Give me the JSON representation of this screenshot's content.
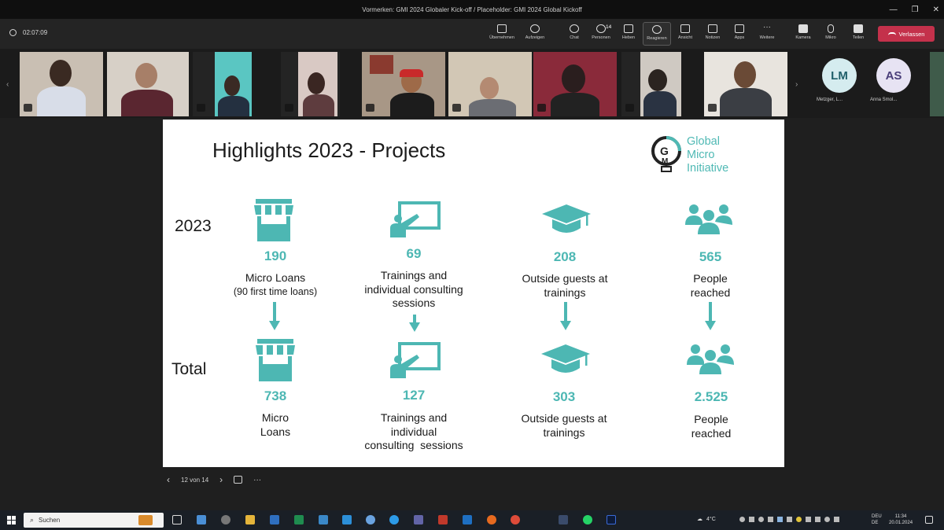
{
  "window": {
    "title": "Vormerken: GMI 2024 Globaler Kick-off / Placeholder: GMI 2024 Global Kickoff",
    "controls": [
      "minimize",
      "maximize",
      "close"
    ]
  },
  "meeting": {
    "timer": "02:07:09",
    "toolbar": [
      {
        "label": "Übernehmen",
        "icon": "share-icon"
      },
      {
        "label": "Aufzeigen",
        "icon": "raise-icon"
      },
      {
        "label": "Chat",
        "icon": "chat-icon"
      },
      {
        "label": "Personen",
        "icon": "people-icon",
        "badge": "14"
      },
      {
        "label": "Heben",
        "icon": "hand-icon"
      },
      {
        "label": "Reagieren",
        "icon": "react-icon"
      },
      {
        "label": "Ansicht",
        "icon": "grid-icon"
      },
      {
        "label": "Notizen",
        "icon": "notes-icon"
      },
      {
        "label": "Apps",
        "icon": "apps-icon"
      },
      {
        "label": "Weitere",
        "icon": "more-icon"
      },
      {
        "label": "Kamera",
        "icon": "camera-icon"
      },
      {
        "label": "Mikro",
        "icon": "mic-icon"
      },
      {
        "label": "Teilen",
        "icon": "share-screen-icon"
      }
    ],
    "leave_label": "Verlassen",
    "participants": [
      {
        "initials": "LM",
        "name": "Metzger, L..."
      },
      {
        "initials": "AS",
        "name": "Anna Smol..."
      }
    ],
    "badge_count": "14"
  },
  "slide": {
    "title": "Highlights 2023 - Projects",
    "logo_lines": [
      "Global",
      "Micro",
      "Initiative"
    ],
    "row_labels": [
      "2023",
      "Total"
    ],
    "columns": [
      {
        "icon": "market-stall-icon",
        "y2023_value": "190",
        "y2023_label": [
          "Micro Loans",
          "(90 first time loans)"
        ],
        "total_value": "738",
        "total_label": [
          "Micro",
          "Loans"
        ]
      },
      {
        "icon": "presentation-icon",
        "y2023_value": "69",
        "y2023_label": [
          "Trainings and",
          "individual consulting",
          "sessions"
        ],
        "total_value": "127",
        "total_label": [
          "Trainings and",
          "individual",
          "consulting  sessions"
        ]
      },
      {
        "icon": "graduation-cap-icon",
        "y2023_value": "208",
        "y2023_label": [
          "Outside guests at",
          "trainings"
        ],
        "total_value": "303",
        "total_label": [
          "Outside guests at",
          "trainings"
        ]
      },
      {
        "icon": "group-icon",
        "y2023_value": "565",
        "y2023_label": [
          "People",
          "reached"
        ],
        "total_value": "2.525",
        "total_label": [
          "People",
          "reached"
        ]
      }
    ],
    "accent_color": "#4db7b3"
  },
  "slide_nav": {
    "page": "12 von 14"
  },
  "taskbar": {
    "search_placeholder": "Suchen",
    "weather": "4°C",
    "lang": "DEU",
    "region": "DE",
    "time": "11:34",
    "date": "20.01.2024"
  }
}
